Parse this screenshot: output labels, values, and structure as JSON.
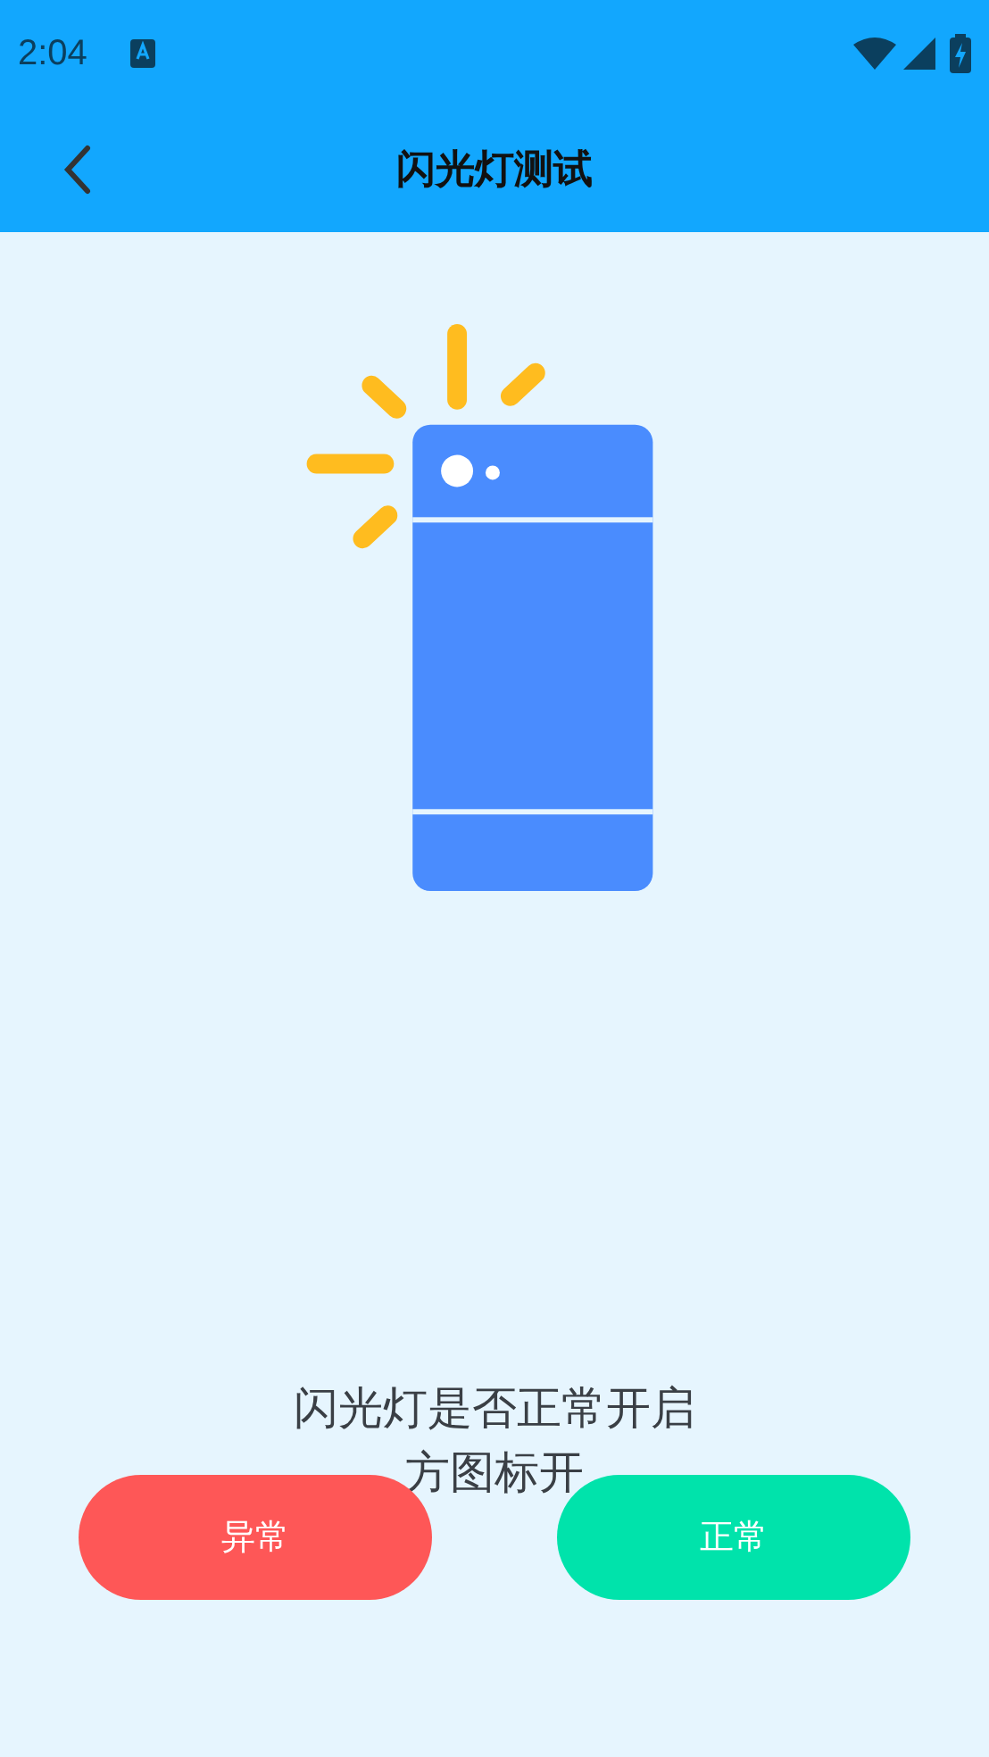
{
  "status_bar": {
    "time": "2:04"
  },
  "header": {
    "title": "闪光灯测试"
  },
  "prompt": {
    "question": "闪光灯是否正常开启",
    "hint_visible_part": "方图标开"
  },
  "buttons": [
    {
      "label": "异常",
      "kind": "abnormal"
    },
    {
      "label": "正常",
      "kind": "normal"
    }
  ]
}
